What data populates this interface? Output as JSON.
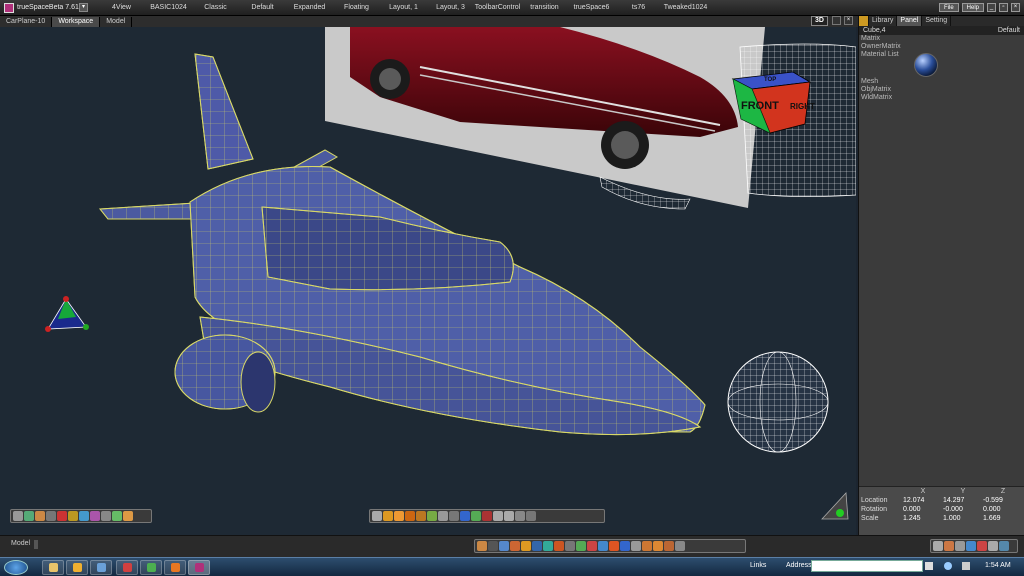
{
  "app": {
    "title": "trueSpaceBeta 7.61"
  },
  "layouts": [
    "4View",
    "BASIC1024",
    "Classic",
    "Default",
    "Expanded",
    "Floating",
    "Layout, 1",
    "Layout, 3",
    "ToolbarControl",
    "transition",
    "trueSpace6",
    "ts76",
    "Tweaked1024"
  ],
  "header_buttons": {
    "file": "File",
    "help": "Help"
  },
  "viewport": {
    "tabs": [
      "CarPlane-10",
      "Workspace",
      "Model"
    ],
    "active_tab": "Workspace",
    "mode_badge": "3D",
    "view_cube": {
      "front": "FRONT",
      "right": "RIGHT",
      "top": "TOP"
    }
  },
  "panel": {
    "tabs": [
      "Library",
      "Panel",
      "Setting"
    ],
    "active_tab": "Panel",
    "object_name": "Cube,4",
    "preset": "Default",
    "properties_top": [
      "Matrix",
      "OwnerMatrix",
      "Material List"
    ],
    "properties_bottom": [
      "Mesh",
      "ObjMatrix",
      "WldMatrix"
    ]
  },
  "transform": {
    "columns": [
      "X",
      "Y",
      "Z"
    ],
    "rows": [
      {
        "label": "Location",
        "values": [
          "12.074",
          "14.297",
          "-0.599"
        ]
      },
      {
        "label": "Rotation",
        "values": [
          "0.000",
          "-0.000",
          "0.000"
        ]
      },
      {
        "label": "Scale",
        "values": [
          "1.245",
          "1.000",
          "1.669"
        ]
      }
    ]
  },
  "status": {
    "text": "Model"
  },
  "taskbar": {
    "links": "Links",
    "address": "Address",
    "clock": "1:54 AM"
  }
}
